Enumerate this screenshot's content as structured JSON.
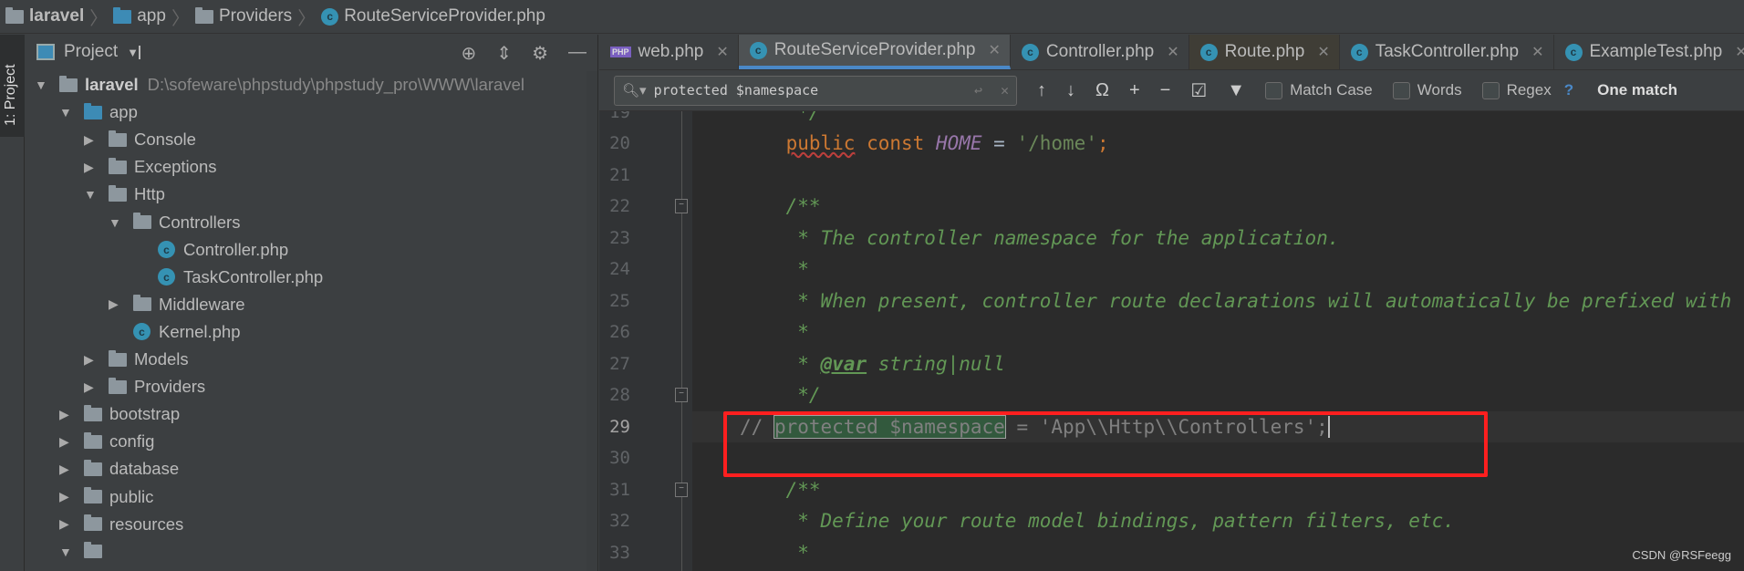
{
  "breadcrumb": [
    {
      "label": "laravel",
      "icon": "folder-icon",
      "bold": true
    },
    {
      "label": "app",
      "icon": "folder-blue-icon"
    },
    {
      "label": "Providers",
      "icon": "folder-icon"
    },
    {
      "label": "RouteServiceProvider.php",
      "icon": "php-class-icon"
    }
  ],
  "sidebar_strip": {
    "label": "1: Project"
  },
  "project_panel": {
    "title": "Project",
    "root_path": "D:\\sofeware\\phpstudy\\phpstudy_pro\\WWW\\laravel",
    "tree": [
      {
        "label": "laravel",
        "depth": 0,
        "type": "folder",
        "expanded": true,
        "bold": true
      },
      {
        "label": "app",
        "depth": 1,
        "type": "folder-blue",
        "expanded": true
      },
      {
        "label": "Console",
        "depth": 2,
        "type": "folder",
        "expanded": false
      },
      {
        "label": "Exceptions",
        "depth": 2,
        "type": "folder",
        "expanded": false
      },
      {
        "label": "Http",
        "depth": 2,
        "type": "folder",
        "expanded": true
      },
      {
        "label": "Controllers",
        "depth": 3,
        "type": "folder",
        "expanded": true
      },
      {
        "label": "Controller.php",
        "depth": 4,
        "type": "class"
      },
      {
        "label": "TaskController.php",
        "depth": 4,
        "type": "class"
      },
      {
        "label": "Middleware",
        "depth": 3,
        "type": "folder",
        "expanded": false
      },
      {
        "label": "Kernel.php",
        "depth": 3,
        "type": "class"
      },
      {
        "label": "Models",
        "depth": 2,
        "type": "folder",
        "expanded": false
      },
      {
        "label": "Providers",
        "depth": 2,
        "type": "folder",
        "expanded": false
      },
      {
        "label": "bootstrap",
        "depth": 1,
        "type": "folder",
        "expanded": false
      },
      {
        "label": "config",
        "depth": 1,
        "type": "folder",
        "expanded": false
      },
      {
        "label": "database",
        "depth": 1,
        "type": "folder",
        "expanded": false
      },
      {
        "label": "public",
        "depth": 1,
        "type": "folder",
        "expanded": false
      },
      {
        "label": "resources",
        "depth": 1,
        "type": "folder",
        "expanded": false
      },
      {
        "label": "",
        "depth": 1,
        "type": "folder",
        "expanded": true
      }
    ]
  },
  "tabs": [
    {
      "label": "web.php",
      "icon": "php-file-icon"
    },
    {
      "label": "RouteServiceProvider.php",
      "icon": "php-class-icon",
      "active": true
    },
    {
      "label": "Controller.php",
      "icon": "php-class-icon"
    },
    {
      "label": "Route.php",
      "icon": "php-class-icon",
      "style": "brown"
    },
    {
      "label": "TaskController.php",
      "icon": "php-class-icon"
    },
    {
      "label": "ExampleTest.php",
      "icon": "php-test-class-icon"
    }
  ],
  "find": {
    "query": "protected $namespace",
    "match_case": "Match Case",
    "words": "Words",
    "regex": "Regex",
    "help": "?",
    "result": "One match",
    "match_case_checked": false,
    "words_checked": false,
    "regex_checked": false
  },
  "editor": {
    "current_line": 29,
    "lines": [
      {
        "n": 19,
        "tokens": [
          {
            "t": "     */",
            "c": "dc"
          }
        ]
      },
      {
        "n": 20,
        "tokens": [
          {
            "t": "    "
          },
          {
            "t": "public",
            "c": "kw wavy"
          },
          {
            "t": " const ",
            "c": "kw"
          },
          {
            "t": "HOME",
            "c": "cn"
          },
          {
            "t": " = "
          },
          {
            "t": "'/home'",
            "c": "st"
          },
          {
            "t": ";",
            "c": "kw"
          }
        ]
      },
      {
        "n": 21,
        "tokens": []
      },
      {
        "n": 22,
        "fold": true,
        "tokens": [
          {
            "t": "    /**",
            "c": "dc"
          }
        ]
      },
      {
        "n": 23,
        "tokens": [
          {
            "t": "     * The controller namespace for the application.",
            "c": "dc"
          }
        ]
      },
      {
        "n": 24,
        "tokens": [
          {
            "t": "     *",
            "c": "dc"
          }
        ]
      },
      {
        "n": 25,
        "tokens": [
          {
            "t": "     * When present, controller route declarations will automatically be prefixed with this namespace.",
            "c": "dc"
          }
        ]
      },
      {
        "n": 26,
        "tokens": [
          {
            "t": "     *",
            "c": "dc"
          }
        ]
      },
      {
        "n": 27,
        "tokens": [
          {
            "t": "     * ",
            "c": "dc"
          },
          {
            "t": "@var",
            "c": "tag"
          },
          {
            "t": " string|null",
            "c": "dc"
          }
        ]
      },
      {
        "n": 28,
        "fold": true,
        "tokens": [
          {
            "t": "     */",
            "c": "dc"
          }
        ]
      },
      {
        "n": 29,
        "tokens": [
          {
            "t": "// ",
            "c": "lc"
          },
          {
            "t": "protected $namespace",
            "c": "lc match"
          },
          {
            "t": " = 'App\\\\Http\\\\Controllers';",
            "c": "lc caret"
          }
        ]
      },
      {
        "n": 30,
        "tokens": []
      },
      {
        "n": 31,
        "fold": true,
        "tokens": [
          {
            "t": "    /**",
            "c": "dc"
          }
        ]
      },
      {
        "n": 32,
        "tokens": [
          {
            "t": "     * Define your route model bindings, pattern filters, etc.",
            "c": "dc"
          }
        ]
      },
      {
        "n": 33,
        "tokens": [
          {
            "t": "     *",
            "c": "dc"
          }
        ]
      }
    ]
  },
  "annotation": {
    "color": "#ff1f1f"
  },
  "watermark": "CSDN @RSFeegg",
  "colors": {
    "accent": "#4a88c7",
    "keyword": "#cc7832",
    "string": "#6a8759",
    "doc_comment": "#629755",
    "constant": "#9876aa"
  }
}
